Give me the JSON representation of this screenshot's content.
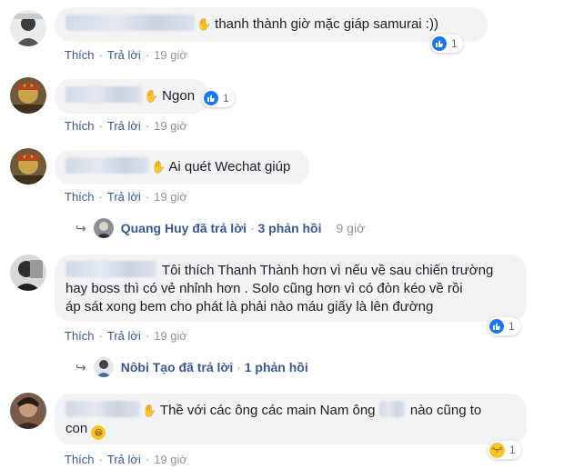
{
  "labels": {
    "like": "Thích",
    "reply": "Trả lời",
    "separator": "·"
  },
  "comments": [
    {
      "text": "thanh thành giờ mặc giáp samurai :))",
      "time": "19 giờ",
      "reaction_type": "like",
      "reaction_count": "1"
    },
    {
      "text": "Ngon",
      "time": "19 giờ",
      "reaction_type": "like",
      "reaction_count": "1"
    },
    {
      "text": "Ai quét Wechat giúp",
      "time": "19 giờ"
    },
    {
      "text_line1": "Tôi thích Thanh Thành hơn vì nếu về sau chiến trường",
      "text_line2": "hay boss thì có vẻ nhỉnh hơn . Solo cũng hơn vì có đòn kéo về rồi",
      "text_line3": "áp sát xong bem cho phát là phải nào máu giấy là lên đường",
      "time": "19 giờ",
      "reaction_type": "like",
      "reaction_count": "1"
    },
    {
      "text_a": "Thề với các ông các main Nam ông",
      "text_b": "nào cũng to",
      "text_line2": "con",
      "time": "19 giờ",
      "reaction_type": "haha",
      "reaction_count": "1"
    }
  ],
  "replies": [
    {
      "author": "Quang Huy",
      "action": "đã trả lời",
      "count": "3 phản hồi",
      "time": "9 giờ"
    },
    {
      "author": "Nôbi Tạo",
      "action": "đã trả lời",
      "count": "1 phản hồi"
    }
  ],
  "colors": {
    "bubble": "#f2f3f5",
    "link": "#385898",
    "like_blue": "#1877f2",
    "haha_yellow": "#f7c52b"
  }
}
